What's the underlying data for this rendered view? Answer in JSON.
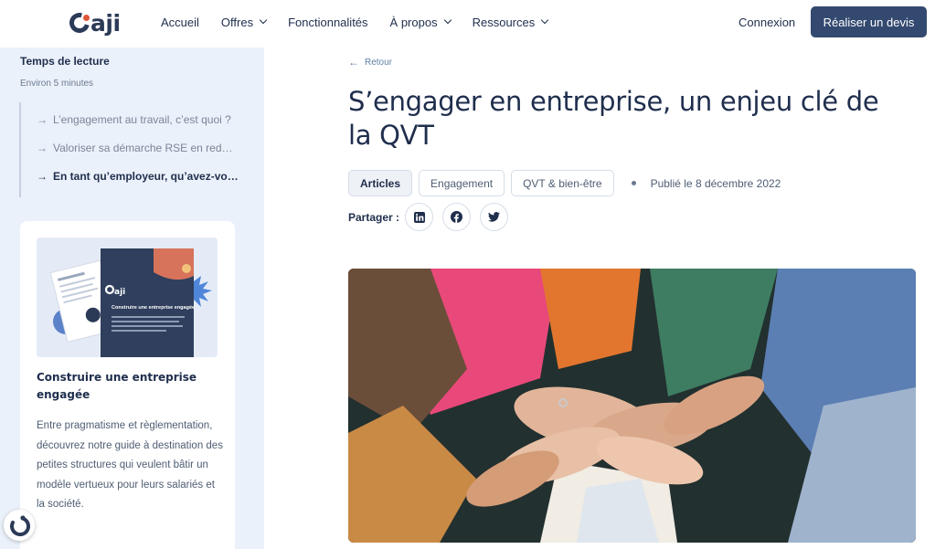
{
  "header": {
    "logo_text": "aji",
    "nav": [
      {
        "label": "Accueil",
        "has_menu": false
      },
      {
        "label": "Offres",
        "has_menu": true
      },
      {
        "label": "Fonctionnalités",
        "has_menu": false
      },
      {
        "label": "À propos",
        "has_menu": true
      },
      {
        "label": "Ressources",
        "has_menu": true
      }
    ],
    "login_label": "Connexion",
    "cta_label": "Réaliser un devis"
  },
  "sidebar": {
    "toc_title": "Temps de lecture",
    "reading_time": "Environ 5 minutes",
    "toc_items": [
      {
        "label": "L’engagement au travail, c’est quoi ?",
        "active": false
      },
      {
        "label": "Valoriser sa démarche RSE en red…",
        "active": false
      },
      {
        "label": "En tant qu’employeur, qu’avez-vo…",
        "active": true
      }
    ],
    "card": {
      "cover_logo": "aji",
      "cover_title": "Construire une entreprise engagée",
      "title": "Construire une entreprise engagée",
      "description": "Entre pragmatisme et règlementation,  découvrez notre guide à destination des petites structures qui veulent bâtir un modèle vertueux pour leurs salariés et la société."
    }
  },
  "article": {
    "back_label": "Retour",
    "title": "S’engager en entreprise, un enjeu clé de la QVT",
    "tags": [
      {
        "label": "Articles",
        "primary": true
      },
      {
        "label": "Engagement",
        "primary": false
      },
      {
        "label": "QVT & bien-être",
        "primary": false
      }
    ],
    "published": "Publié le 8 décembre 2022",
    "share_label": "Partager :",
    "share_icons": [
      "linkedin-icon",
      "facebook-icon",
      "twitter-icon"
    ]
  },
  "colors": {
    "brand_navy": "#33496f",
    "brand_orange": "#e0573a",
    "sidebar_bg": "#ebf1fa"
  }
}
